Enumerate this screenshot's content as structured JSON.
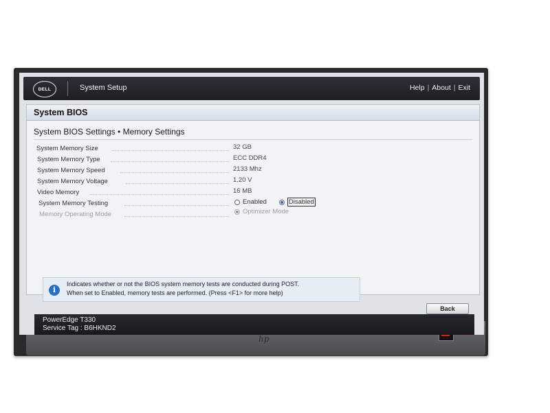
{
  "app": {
    "title": "System Setup",
    "logo_text": "DELL",
    "links": [
      "Help",
      "About",
      "Exit"
    ],
    "link_separator": "|"
  },
  "section": {
    "title": "System BIOS",
    "page_title": "System BIOS Settings • Memory Settings"
  },
  "settings": [
    {
      "label": "System Memory Size",
      "value": "32 GB"
    },
    {
      "label": "System Memory Type",
      "value": "ECC DDR4"
    },
    {
      "label": "System Memory Speed",
      "value": "2133 Mhz"
    },
    {
      "label": "System Memory Voltage",
      "value": "1.20 V"
    },
    {
      "label": "Video Memory",
      "value": "16 MB"
    },
    {
      "label": "System Memory Testing",
      "options": [
        "Enabled",
        "Disabled"
      ],
      "selected": "Disabled"
    },
    {
      "label": "Memory Operating Mode",
      "options": [
        "Optimizer Mode"
      ],
      "selected": "Optimizer Mode",
      "disabled": true
    }
  ],
  "help": {
    "line1": "Indicates whether or not the BIOS system memory tests are conducted during POST.",
    "line2": "When set to Enabled, memory tests are performed. (Press <F1> for more help)"
  },
  "back_label": "Back",
  "footer": {
    "model": "PowerEdge T330",
    "service_tag": "Service Tag : B6HKND2"
  },
  "monitor": {
    "brand_mark": "hp"
  },
  "colors": {
    "screen_background": "#dfe3e8",
    "topbar": "#1c1f24",
    "info_icon": "#2b6fc4",
    "selected_radio": "#3467c0"
  }
}
